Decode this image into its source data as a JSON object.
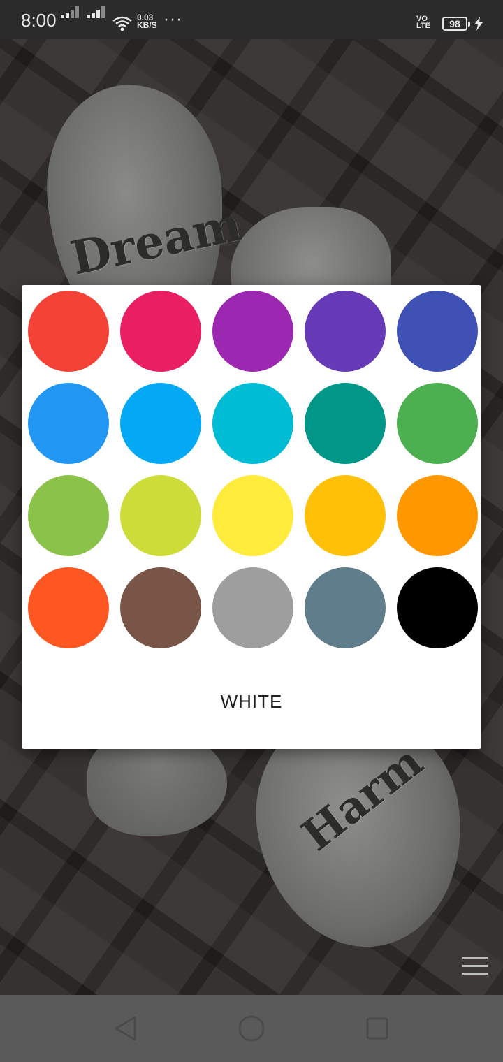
{
  "status_bar": {
    "time": "8:00",
    "net_speed_value": "0.03",
    "net_speed_unit": "KB/S",
    "overflow": "···",
    "volte_top": "VO",
    "volte_bottom": "LTE",
    "battery_level": "98"
  },
  "wallpaper": {
    "engraving_1": "Dream",
    "engraving_2": "Harm"
  },
  "color_picker": {
    "colors": [
      {
        "name": "red",
        "hex": "#F44336"
      },
      {
        "name": "pink",
        "hex": "#E91E63"
      },
      {
        "name": "purple",
        "hex": "#9C27B0"
      },
      {
        "name": "deep-purple",
        "hex": "#673AB7"
      },
      {
        "name": "indigo",
        "hex": "#3F51B5"
      },
      {
        "name": "blue",
        "hex": "#2196F3"
      },
      {
        "name": "light-blue",
        "hex": "#03A9F4"
      },
      {
        "name": "cyan",
        "hex": "#00BCD4"
      },
      {
        "name": "teal",
        "hex": "#009688"
      },
      {
        "name": "green",
        "hex": "#4CAF50"
      },
      {
        "name": "light-green",
        "hex": "#8BC34A"
      },
      {
        "name": "lime",
        "hex": "#CDDC39"
      },
      {
        "name": "yellow",
        "hex": "#FFEB3B"
      },
      {
        "name": "amber",
        "hex": "#FFC107"
      },
      {
        "name": "orange",
        "hex": "#FF9800"
      },
      {
        "name": "deep-orange",
        "hex": "#FF5722"
      },
      {
        "name": "brown",
        "hex": "#795548"
      },
      {
        "name": "grey",
        "hex": "#9E9E9E"
      },
      {
        "name": "blue-grey",
        "hex": "#607D8B"
      },
      {
        "name": "black",
        "hex": "#000000"
      }
    ],
    "white_button_label": "WHITE"
  },
  "icons": {
    "menu": "hamburger-menu-icon",
    "back": "back-triangle-icon",
    "home": "home-circle-icon",
    "recents": "recents-square-icon"
  }
}
